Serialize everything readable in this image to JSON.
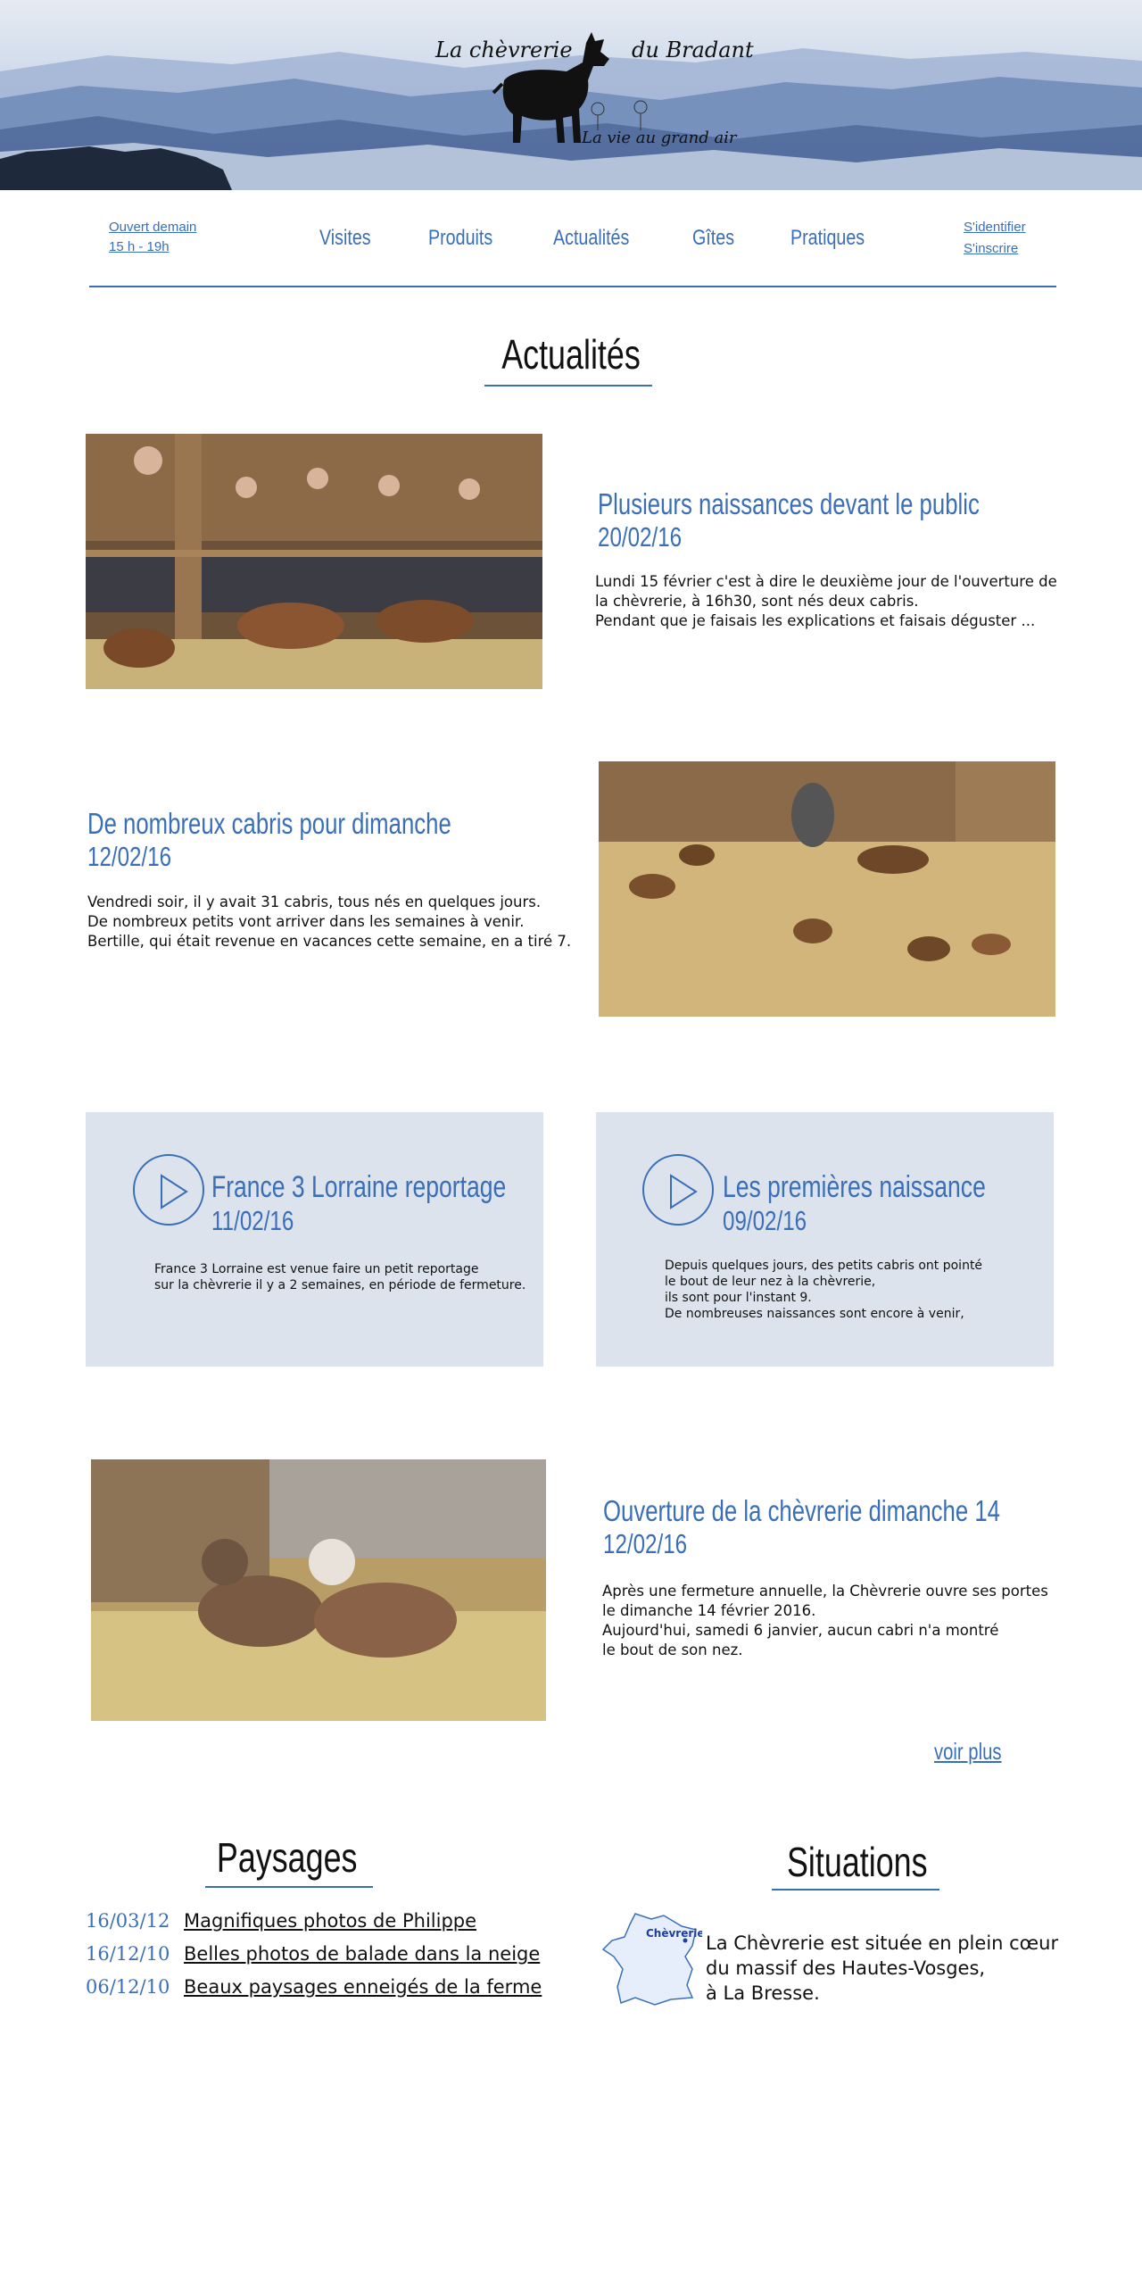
{
  "header": {
    "logo_left": "La chèvrerie",
    "logo_right": "du Bradant",
    "tagline": "La vie au grand air"
  },
  "nav": {
    "hours_line1": "Ouvert demain",
    "hours_line2": "15 h - 19h",
    "menu": [
      "Visites",
      "Produits",
      "Actualités",
      "Gîtes",
      "Pratiques"
    ],
    "login": "S'identifier",
    "signup": "S'inscrire"
  },
  "actualites": {
    "title": "Actualités",
    "items": [
      {
        "title": "Plusieurs naissances devant le public",
        "date": "20/02/16",
        "body": "Lundi 15 février c'est à dire le deuxième jour de l'ouverture de\nla chèvrerie, à 16h30, sont nés deux cabris.\nPendant que je faisais les explications et faisais déguster ..."
      },
      {
        "title": "De nombreux cabris pour dimanche",
        "date": "12/02/16",
        "body": "Vendredi soir, il y avait 31 cabris, tous nés en quelques jours.\nDe nombreux petits vont arriver dans les semaines à venir.\nBertille, qui était revenue en vacances cette semaine, en a tiré 7."
      },
      {
        "title": "Ouverture de la chèvrerie dimanche 14",
        "date": "12/02/16",
        "body": "Après une fermeture annuelle, la Chèvrerie ouvre ses portes\nle dimanche 14 février 2016.\nAujourd'hui, samedi 6 janvier, aucun cabri n'a montré\nle bout de son nez."
      }
    ],
    "videos": [
      {
        "title": "France 3 Lorraine reportage",
        "date": "11/02/16",
        "body": "France 3 Lorraine est venue faire un petit reportage\nsur la chèvrerie il y a 2 semaines, en période de fermeture."
      },
      {
        "title": "Les premières naissance",
        "date": "09/02/16",
        "body": "Depuis quelques jours, des petits cabris ont pointé\nle bout de leur nez à la chèvrerie,\nils sont pour l'instant 9.\nDe nombreuses naissances sont encore à venir,"
      }
    ],
    "more": "voir plus"
  },
  "paysages": {
    "title": "Paysages",
    "items": [
      {
        "date": "16/03/12",
        "label": "Magnifiques photos de Philippe"
      },
      {
        "date": "16/12/10",
        "label": "Belles photos de balade dans la neige"
      },
      {
        "date": "06/12/10",
        "label": "Beaux paysages enneigés de la ferme"
      }
    ]
  },
  "situations": {
    "title": "Situations",
    "map_label": "Chèvrerie",
    "text": "La Chèvrerie est située en plein cœur\ndu massif des Hautes-Vosges,\nà La Bresse."
  },
  "colors": {
    "accent": "#3a6fb8",
    "card_bg": "#dde3ec"
  }
}
